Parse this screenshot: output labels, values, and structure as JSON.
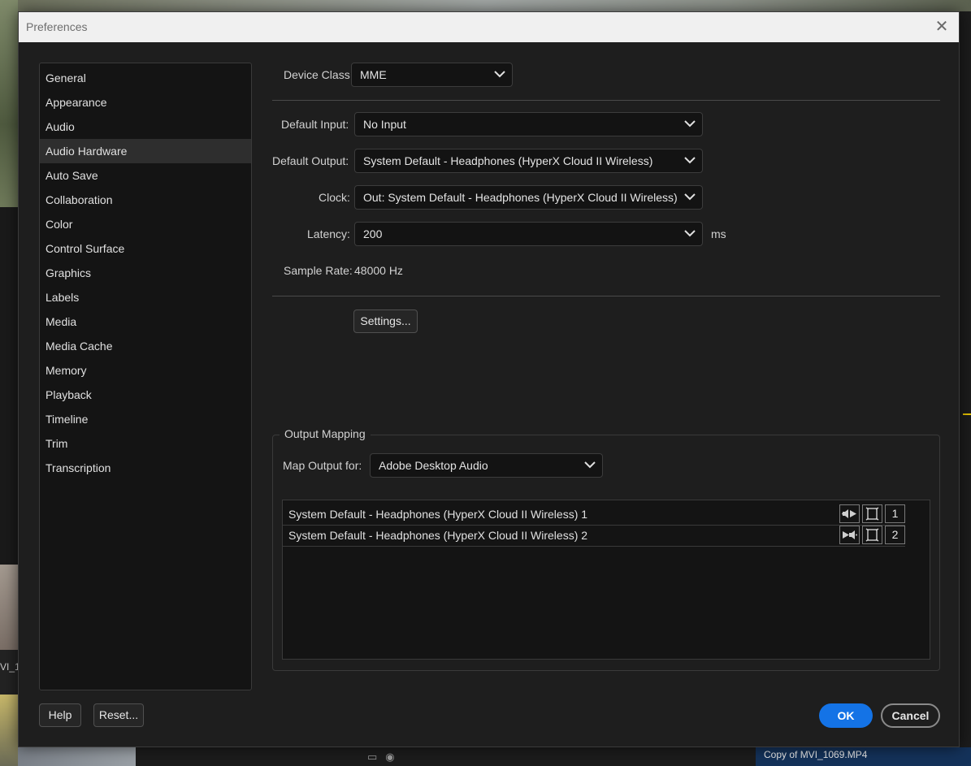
{
  "background": {
    "left_clip_text": "VI_1(",
    "thumbnail_label": "Copy of MVI_1069.MP4"
  },
  "dialog": {
    "title": "Preferences"
  },
  "sidebar": {
    "items": [
      {
        "label": "General"
      },
      {
        "label": "Appearance"
      },
      {
        "label": "Audio"
      },
      {
        "label": "Audio Hardware",
        "active": true
      },
      {
        "label": "Auto Save"
      },
      {
        "label": "Collaboration"
      },
      {
        "label": "Color"
      },
      {
        "label": "Control Surface"
      },
      {
        "label": "Graphics"
      },
      {
        "label": "Labels"
      },
      {
        "label": "Media"
      },
      {
        "label": "Media Cache"
      },
      {
        "label": "Memory"
      },
      {
        "label": "Playback"
      },
      {
        "label": "Timeline"
      },
      {
        "label": "Trim"
      },
      {
        "label": "Transcription"
      }
    ]
  },
  "audio_hardware": {
    "device_class": {
      "label": "Device Class:",
      "value": "MME"
    },
    "default_input": {
      "label": "Default Input:",
      "value": "No Input"
    },
    "default_output": {
      "label": "Default Output:",
      "value": "System Default - Headphones (HyperX Cloud II Wireless)"
    },
    "clock": {
      "label": "Clock:",
      "value": "Out: System Default - Headphones (HyperX Cloud II Wireless)"
    },
    "latency": {
      "label": "Latency:",
      "value": "200",
      "unit": "ms"
    },
    "sample_rate": {
      "label": "Sample Rate:",
      "value": "48000 Hz"
    },
    "settings_button": "Settings..."
  },
  "output_mapping": {
    "title": "Output Mapping",
    "map_output_for": {
      "label": "Map Output for:",
      "value": "Adobe Desktop Audio"
    },
    "rows": [
      {
        "name": "System Default - Headphones (HyperX Cloud II Wireless) 1",
        "channel": "1"
      },
      {
        "name": "System Default - Headphones (HyperX Cloud II Wireless) 2",
        "channel": "2"
      }
    ]
  },
  "footer": {
    "help_label": "Help",
    "reset_label": "Reset...",
    "ok_label": "OK",
    "cancel_label": "Cancel"
  },
  "colors": {
    "accent": "#1473e6",
    "dialog_bg": "#1e1e1e",
    "title_bar": "#f0f0f0"
  }
}
